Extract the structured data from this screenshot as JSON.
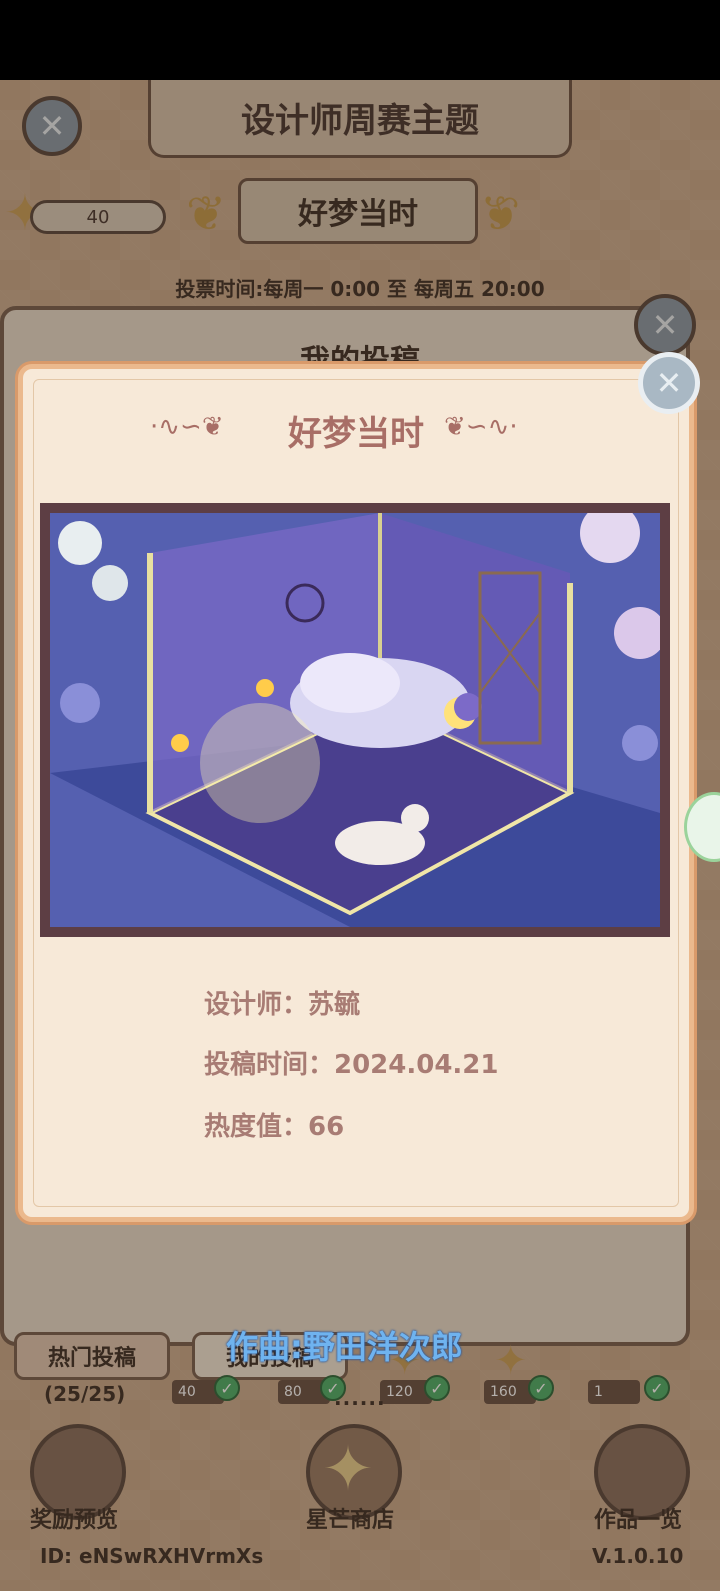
{
  "header": {
    "title": "设计师周赛主题",
    "star_count": "40",
    "theme": "好梦当时",
    "vote_time": "投票时间:每周一  0:00  至  每周五  20:00"
  },
  "back_panel": {
    "title": "我的投稿"
  },
  "modal": {
    "title": "好梦当时",
    "designer": "设计师：苏毓",
    "submit_time": "投稿时间：2024.04.21",
    "heat": "热度值：66"
  },
  "tabs": {
    "hot": "热门投稿",
    "hot_count": "(25/25)",
    "mine": "我的投稿"
  },
  "milestones": [
    {
      "value": "40"
    },
    {
      "value": "80"
    },
    {
      "value": "120"
    },
    {
      "value": "160"
    },
    {
      "value": "1"
    }
  ],
  "lyric": "作曲:野田洋次郎",
  "dots": "......",
  "bottom": {
    "reward": "奖励预览",
    "shop": "星芒商店",
    "works": "作品一览",
    "user_id": "ID:  eNSwRXHVrmXs",
    "version": "V.1.0.10"
  },
  "icons": {
    "close": "close-icon",
    "star": "star-icon",
    "check": "checkmark-icon"
  }
}
